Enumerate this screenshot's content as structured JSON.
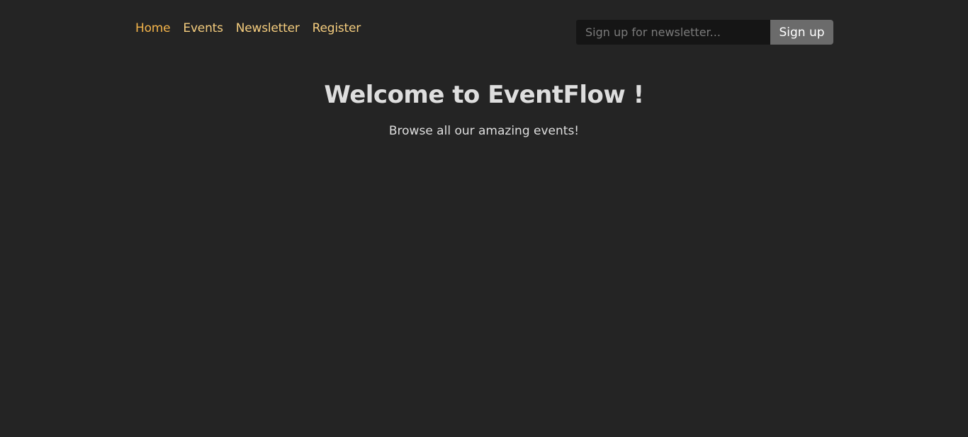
{
  "nav": {
    "items": [
      {
        "label": "Home",
        "active": true
      },
      {
        "label": "Events",
        "active": false
      },
      {
        "label": "Newsletter",
        "active": false
      },
      {
        "label": "Register",
        "active": false
      }
    ]
  },
  "newsletter": {
    "placeholder": "Sign up for newsletter...",
    "value": "",
    "button_label": "Sign up"
  },
  "hero": {
    "title": "Welcome to EventFlow !",
    "subtitle": "Browse all our amazing events!"
  },
  "colors": {
    "background": "#242424",
    "nav_link": "#f5cd7e",
    "nav_link_active": "#f4b44a",
    "input_bg": "#151515",
    "button_bg": "#6b6b6b",
    "text": "#dedede"
  }
}
